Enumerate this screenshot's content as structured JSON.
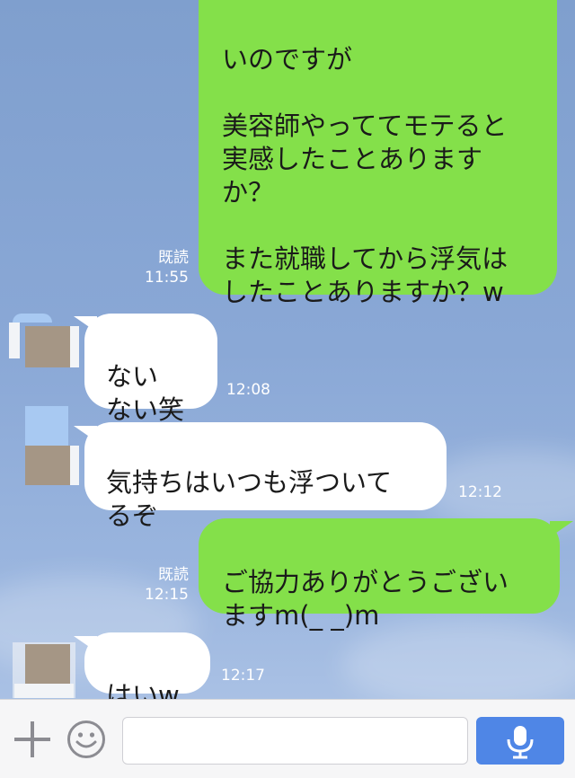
{
  "messages": [
    {
      "id": "m1",
      "side": "out",
      "text": "いのですが\n\n美容師やっててモテると\n実感したことありますか？\n\nまた就職してから浮気は\nしたことありますか？w",
      "read_label": "既読",
      "time": "11:55"
    },
    {
      "id": "m2",
      "side": "in",
      "text": "ない\nない笑",
      "time": "12:08"
    },
    {
      "id": "m3",
      "side": "in",
      "text": "気持ちはいつも浮ついて\nるぞ",
      "time": "12:12"
    },
    {
      "id": "m4",
      "side": "out",
      "text": "ご協力ありがとうござい\nますm(_ _)m",
      "read_label": "既読",
      "time": "12:15"
    },
    {
      "id": "m5",
      "side": "in",
      "text": "はいw",
      "time": "12:17"
    }
  ],
  "input_bar": {
    "placeholder": ""
  },
  "icons": {
    "add": "plus-icon",
    "sticker": "smiley-icon",
    "voice": "microphone-icon"
  },
  "colors": {
    "outgoing_bubble": "#84e04a",
    "incoming_bubble": "#ffffff",
    "mic_button": "#4f86e6"
  }
}
